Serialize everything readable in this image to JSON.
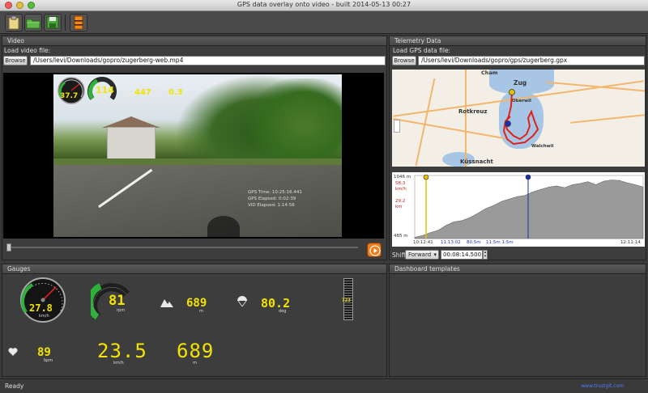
{
  "window": {
    "title": "GPS data overlay onto video - built 2014-05-13 00:27"
  },
  "toolbar": {
    "buttons": [
      {
        "icon": "clipboard-icon"
      },
      {
        "icon": "folder-open-icon"
      },
      {
        "icon": "save-icon"
      },
      {
        "icon": "film-icon"
      }
    ]
  },
  "video_panel": {
    "title": "Video",
    "load_label": "Load video file:",
    "browse_label": "Browse",
    "path": "/Users/levi/Downloads/gopro/zugerberg-web.mp4",
    "overlay": {
      "speed": "37.7",
      "cadence": "114",
      "altitude": "447",
      "heading": "0.3",
      "info_lines": [
        "GPS Time: 10:25:16.441",
        "GPS Elapsed: 0:02:39",
        "VID Elapsed: 1:14:56"
      ]
    }
  },
  "telemetry_panel": {
    "title": "Telemetry Data",
    "load_label": "Load GPS data file:",
    "browse_label": "Browse",
    "path": "/Users/levi/Downloads/gopro/gps/zugerberg.gpx",
    "map_labels": [
      "Cham",
      "Zug",
      "Rotkreuz",
      "Küssnacht",
      "Oberwil",
      "Walchwil"
    ],
    "elevation": {
      "top_value": "1046 m",
      "speed_value": "58.3",
      "speed_unit": "km/h",
      "dist_value": "29.2",
      "dist_unit": "km",
      "bottom_value": "485 m",
      "time_start": "10:12:41",
      "time_cursor": "11:13:02",
      "dist_cursor": "80.5m",
      "time_cursor2": "11:5m 1:5m",
      "time_end": "12:11:14",
      "profile": [
        0.02,
        0.05,
        0.1,
        0.14,
        0.22,
        0.28,
        0.3,
        0.35,
        0.42,
        0.5,
        0.55,
        0.62,
        0.66,
        0.7,
        0.72,
        0.78,
        0.82,
        0.86,
        0.88,
        0.85,
        0.9,
        0.92,
        0.95,
        0.9,
        0.96,
        0.98,
        0.97,
        0.93,
        0.9,
        0.86
      ]
    },
    "shift_label": "Shift",
    "shift_direction": "Forward",
    "shift_time": "00:08:14.500"
  },
  "gauges_panel": {
    "title": "Gauges",
    "speed_dial": {
      "value": "27.8",
      "unit": "km/h"
    },
    "cadence_dial": {
      "value": "81",
      "unit": "rpm"
    },
    "altitude": {
      "value": "689",
      "unit": "m",
      "icon": "mountain-icon"
    },
    "heading": {
      "value": "80.2",
      "unit": "deg",
      "icon": "parachute-icon"
    },
    "slider_value": "723",
    "heart": {
      "value": "89",
      "unit": "bpm",
      "icon": "heart-icon"
    },
    "speed_digital": {
      "value": "23.5",
      "unit": "km/h"
    },
    "altitude_digital": {
      "value": "689",
      "unit": "m"
    }
  },
  "dashboard_panel": {
    "title": "Dashboard templates"
  },
  "status": {
    "text": "Ready",
    "link": "www.trustgit.com"
  },
  "colors": {
    "accent_yellow": "#f2e400",
    "play_orange": "#f07b1a",
    "track_red": "#e0201a",
    "cursor_yellow": "#e8c000",
    "cursor_blue": "#1a2fb0"
  }
}
